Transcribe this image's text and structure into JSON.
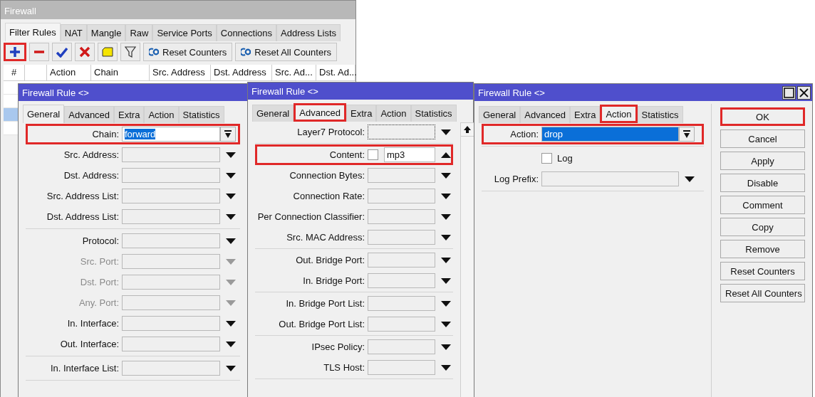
{
  "firewall_window": {
    "title": "Firewall",
    "tabs": [
      {
        "label": "Filter Rules",
        "selected": true
      },
      {
        "label": "NAT",
        "selected": false
      },
      {
        "label": "Mangle",
        "selected": false
      },
      {
        "label": "Raw",
        "selected": false
      },
      {
        "label": "Service Ports",
        "selected": false
      },
      {
        "label": "Connections",
        "selected": false
      },
      {
        "label": "Address Lists",
        "selected": false
      }
    ],
    "toolbar": [
      {
        "kind": "add",
        "highlighted": true
      },
      {
        "kind": "remove",
        "highlighted": false
      },
      {
        "kind": "enable",
        "highlighted": false
      },
      {
        "kind": "disable",
        "highlighted": false
      },
      {
        "kind": "comment",
        "highlighted": false
      },
      {
        "kind": "filter",
        "highlighted": false
      },
      {
        "kind": "reset",
        "label": "Reset Counters",
        "highlighted": false
      },
      {
        "kind": "reset",
        "label": "Reset All Counters",
        "highlighted": false
      }
    ],
    "table": {
      "columns": [
        {
          "label": "#"
        },
        {},
        {
          "label": "Action"
        },
        {
          "label": "Chain"
        },
        {
          "label": "Src. Address"
        },
        {
          "label": "Dst. Address"
        },
        {
          "label": "Src. Ad..."
        },
        {
          "label": "Dst. Ad..."
        }
      ],
      "rows": [
        {
          "selected": false
        },
        {
          "selected": false
        },
        {
          "selected": true
        },
        {
          "selected": false
        }
      ]
    }
  },
  "rule_dialogs": [
    {
      "title": "Firewall Rule <>",
      "tabs": [
        {
          "label": "General",
          "selected": true,
          "highlighted": false
        },
        {
          "label": "Advanced",
          "selected": false,
          "highlighted": false
        },
        {
          "label": "Extra",
          "selected": false,
          "highlighted": false
        },
        {
          "label": "Action",
          "selected": false,
          "highlighted": false
        },
        {
          "label": "Statistics",
          "selected": false,
          "highlighted": false
        }
      ],
      "groups": [
        [
          {
            "kind": "combo",
            "label": "Chain:",
            "value": "forward",
            "value_selected": true,
            "highlighted": true
          },
          {
            "kind": "dropdown",
            "label": "Src. Address:",
            "disabled": false
          },
          {
            "kind": "dropdown",
            "label": "Dst. Address:",
            "disabled": false
          },
          {
            "kind": "dropdown",
            "label": "Src. Address List:",
            "disabled": false
          },
          {
            "kind": "dropdown",
            "label": "Dst. Address List:",
            "disabled": false
          }
        ],
        [
          {
            "kind": "dropdown",
            "label": "Protocol:",
            "disabled": false
          },
          {
            "kind": "dropdown",
            "label": "Src. Port:",
            "disabled": true
          },
          {
            "kind": "dropdown",
            "label": "Dst. Port:",
            "disabled": true
          },
          {
            "kind": "dropdown",
            "label": "Any. Port:",
            "disabled": true
          },
          {
            "kind": "dropdown",
            "label": "In. Interface:",
            "disabled": false
          },
          {
            "kind": "dropdown",
            "label": "Out. Interface:",
            "disabled": false
          }
        ],
        [
          {
            "kind": "dropdown",
            "label": "In. Interface List:",
            "disabled": false
          }
        ]
      ]
    },
    {
      "title": "Firewall Rule <>",
      "scrollbar": true,
      "tabs": [
        {
          "label": "General",
          "selected": false,
          "highlighted": false
        },
        {
          "label": "Advanced",
          "selected": true,
          "highlighted": true
        },
        {
          "label": "Extra",
          "selected": false,
          "highlighted": false
        },
        {
          "label": "Action",
          "selected": false,
          "highlighted": false
        },
        {
          "label": "Statistics",
          "selected": false,
          "highlighted": false
        }
      ],
      "groups": [
        [
          {
            "kind": "dropdown",
            "label": "Layer7 Protocol:",
            "disabled": false,
            "focused": true
          }
        ],
        [
          {
            "kind": "content",
            "label": "Content:",
            "checked": false,
            "value": "mp3",
            "highlighted": true
          },
          {
            "kind": "dropdown",
            "label": "Connection Bytes:",
            "disabled": false
          },
          {
            "kind": "dropdown",
            "label": "Connection Rate:",
            "disabled": false
          },
          {
            "kind": "dropdown",
            "label": "Per Connection Classifier:",
            "disabled": false
          },
          {
            "kind": "dropdown",
            "label": "Src. MAC Address:",
            "disabled": false
          }
        ],
        [
          {
            "kind": "dropdown",
            "label": "Out. Bridge Port:",
            "disabled": false
          },
          {
            "kind": "dropdown",
            "label": "In. Bridge Port:",
            "disabled": false
          }
        ],
        [
          {
            "kind": "dropdown",
            "label": "In. Bridge Port List:",
            "disabled": false
          },
          {
            "kind": "dropdown",
            "label": "Out. Bridge Port List:",
            "disabled": false
          }
        ],
        [
          {
            "kind": "dropdown",
            "label": "IPsec Policy:",
            "disabled": false
          },
          {
            "kind": "dropdown",
            "label": "TLS Host:",
            "disabled": false
          }
        ]
      ]
    },
    {
      "title": "Firewall Rule <>",
      "window_controls": [
        {
          "kind": "maximize"
        },
        {
          "kind": "close"
        }
      ],
      "tabs": [
        {
          "label": "General",
          "selected": false,
          "highlighted": false
        },
        {
          "label": "Advanced",
          "selected": false,
          "highlighted": false
        },
        {
          "label": "Extra",
          "selected": false,
          "highlighted": false
        },
        {
          "label": "Action",
          "selected": true,
          "highlighted": true
        },
        {
          "label": "Statistics",
          "selected": false,
          "highlighted": false
        }
      ],
      "groups": [
        [
          {
            "kind": "combo",
            "label": "Action:",
            "value": "drop",
            "value_selected": true,
            "highlighted": true
          }
        ],
        [
          {
            "kind": "checkbox",
            "label": "Log",
            "checked": false
          },
          {
            "kind": "dropdown",
            "label": "Log Prefix:",
            "disabled": false
          }
        ]
      ],
      "buttons": [
        {
          "label": "OK",
          "highlighted": true
        },
        {
          "label": "Cancel",
          "highlighted": false
        },
        {
          "label": "Apply",
          "highlighted": false
        },
        {
          "label": "Disable",
          "highlighted": false
        },
        {
          "label": "Comment",
          "highlighted": false
        },
        {
          "label": "Copy",
          "highlighted": false
        },
        {
          "label": "Remove",
          "highlighted": false
        },
        {
          "label": "Reset Counters",
          "highlighted": false
        },
        {
          "label": "Reset All Counters",
          "highlighted": false
        }
      ]
    }
  ]
}
